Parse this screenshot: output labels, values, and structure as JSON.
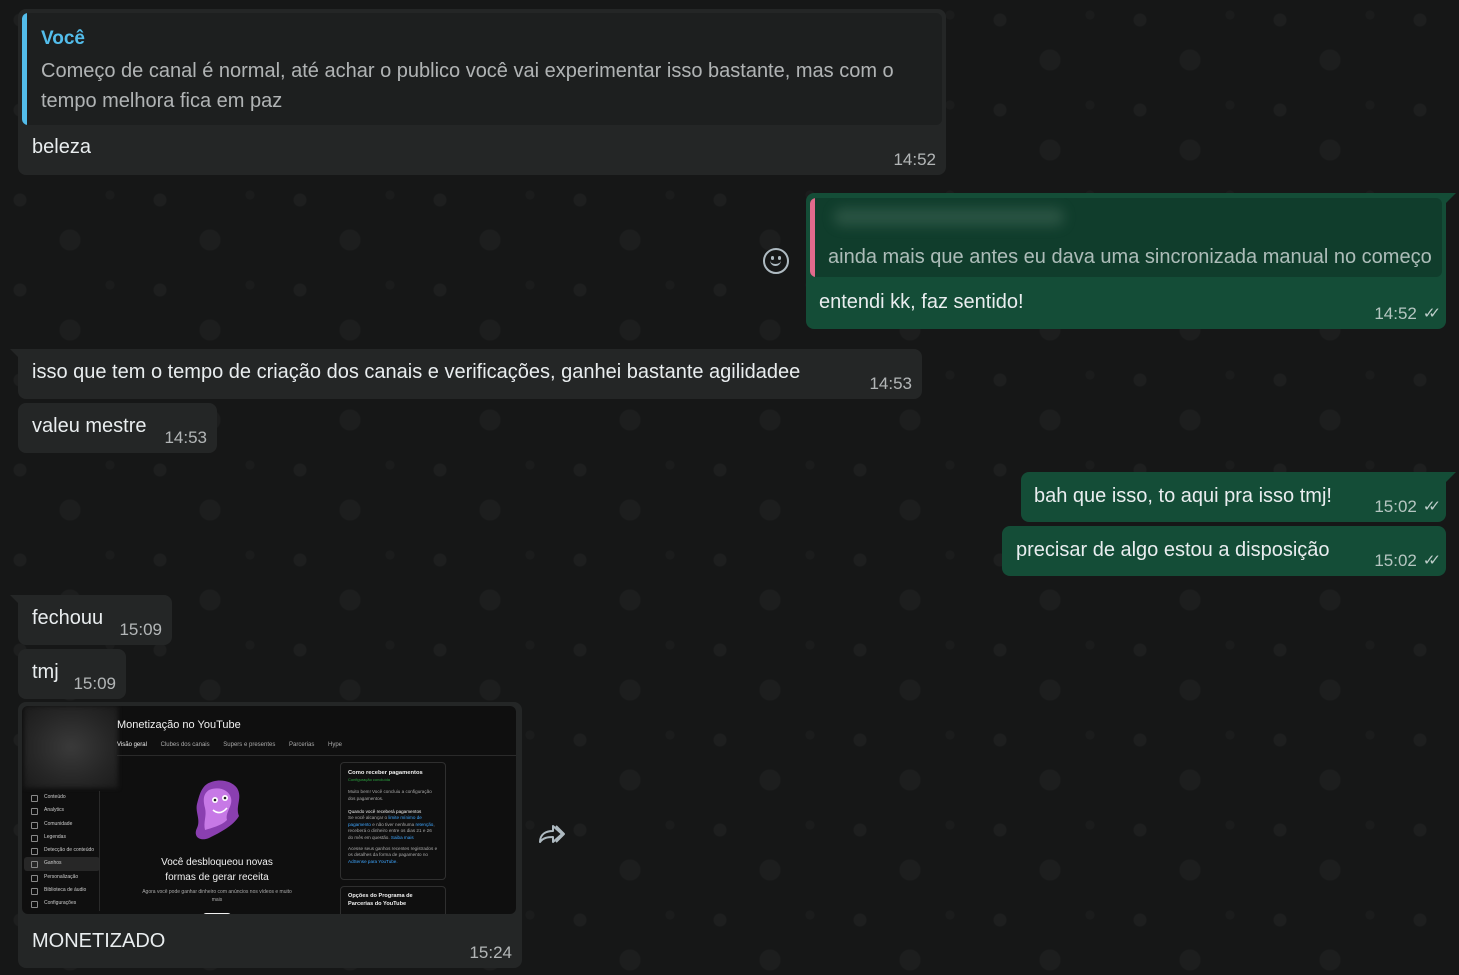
{
  "messages": {
    "m1": {
      "quote_author": "Você",
      "quote_text_line1": "Começo de canal é normal, até achar o publico você vai experimentar isso bastante, mas com o",
      "quote_text_line2": "tempo melhora fica em paz",
      "text": "beleza",
      "time": "14:52"
    },
    "m2": {
      "quote_text": "ainda mais que antes eu dava uma sincronizada manual no começo",
      "text": "entendi kk, faz sentido!",
      "time": "14:52",
      "status": "read"
    },
    "m3": {
      "text": "isso que tem o tempo de criação dos canais e verificações, ganhei bastante agilidadee",
      "time": "14:53"
    },
    "m4": {
      "text": "valeu mestre",
      "time": "14:53"
    },
    "m5": {
      "text": "bah que isso, to aqui pra isso tmj!",
      "time": "15:02",
      "status": "read"
    },
    "m6": {
      "text": "precisar de algo estou a disposição",
      "time": "15:02",
      "status": "read"
    },
    "m7": {
      "text": "fechouu",
      "time": "15:09"
    },
    "m8": {
      "text": "tmj",
      "time": "15:09"
    },
    "m9": {
      "caption": "MONETIZADO",
      "time": "15:24",
      "image": {
        "title": "Monetização no YouTube",
        "tabs": [
          "Visão geral",
          "Clubes dos canais",
          "Supers e presentes",
          "Parcerias",
          "Hype"
        ],
        "sidebar": [
          "Conteúdo",
          "Analytics",
          "Comunidade",
          "Legendas",
          "Detecção de conteúdo",
          "Ganhos",
          "Personalização",
          "Biblioteca de áudio",
          "Configurações"
        ],
        "headline_line1": "Você desbloqueou novas",
        "headline_line2": "formas de gerar receita",
        "subtext": "Agora você pode ganhar dinheiro com anúncios nos vídeos e muito mais",
        "card1_title": "Como receber pagamentos",
        "card1_badge": "Configuração concluída",
        "card1_p1": "Muito bem! Você concluiu a configuração dos pagamentos.",
        "card1_sub": "Quando você receberá pagamentos",
        "card1_p2a": "Se você alcançar o",
        "card1_link1": "limite mínimo de pagamento",
        "card1_p2b": "e não tiver nenhuma",
        "card1_link2": "retenção",
        "card1_p2c": ", receberá o dinheiro entre os dias 21 e 26 do mês em questão.",
        "card1_link3": "Saiba mais",
        "card1_p3": "Acesse seus ganhos recentes registrados e os detalhes da forma de pagamento no",
        "card1_link4": "AdSense para YouTube.",
        "card2_title": "Opções do Programa de Parcerias do YouTube"
      }
    }
  },
  "icons": {
    "emoji_button": "smiley-icon",
    "forward_button": "forward-icon",
    "read_receipt": "double-check-icon"
  },
  "colors": {
    "incoming_bubble": "#242626",
    "outgoing_bubble": "#144d37",
    "quote_you_accent": "#53bdeb",
    "quote_other_accent": "#e26a8c"
  }
}
